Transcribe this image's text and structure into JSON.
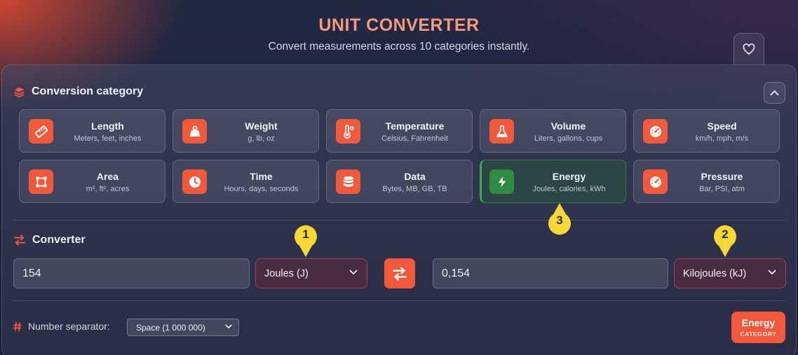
{
  "header": {
    "title": "UNIT CONVERTER",
    "subtitle": "Convert measurements across 10 categories instantly."
  },
  "favorite": {
    "icon": "heart-icon"
  },
  "category_section": {
    "title": "Conversion category",
    "icon": "layers-icon",
    "collapse_icon": "chevron-up-icon"
  },
  "categories": [
    {
      "name": "Length",
      "desc": "Meters, feet, inches",
      "icon": "ruler-icon"
    },
    {
      "name": "Weight",
      "desc": "g, lb, oz",
      "icon": "weight-icon"
    },
    {
      "name": "Temperature",
      "desc": "Celsius, Fahrenheit",
      "icon": "thermometer-icon"
    },
    {
      "name": "Volume",
      "desc": "Liters, gallons, cups",
      "icon": "flask-icon"
    },
    {
      "name": "Speed",
      "desc": "km/h, mph, m/s",
      "icon": "gauge-icon"
    },
    {
      "name": "Area",
      "desc": "m², ft², acres",
      "icon": "area-icon"
    },
    {
      "name": "Time",
      "desc": "Hours, days, seconds",
      "icon": "clock-icon"
    },
    {
      "name": "Data",
      "desc": "Bytes, MB, GB, TB",
      "icon": "database-icon"
    },
    {
      "name": "Energy",
      "desc": "Joules, calories, kWh",
      "icon": "bolt-icon",
      "active": true
    },
    {
      "name": "Pressure",
      "desc": "Bar, PSI, atm",
      "icon": "gauge-icon"
    }
  ],
  "converter": {
    "title": "Converter",
    "icon": "swap-arrows-icon",
    "from_value": "154",
    "from_unit": "Joules (J)",
    "to_value": "0,154",
    "to_unit": "Kilojoules (kJ)"
  },
  "separator": {
    "label": "Number separator:",
    "icon": "hash-icon",
    "value": "Space (1 000 000)"
  },
  "badge": {
    "title": "Energy",
    "subtitle": "CATEGORY"
  },
  "markers": [
    "1",
    "2",
    "3"
  ],
  "colors": {
    "accent": "#f2593a",
    "active_category": "#2f8a43",
    "marker": "#f7d733",
    "title": "#f19a7e"
  }
}
